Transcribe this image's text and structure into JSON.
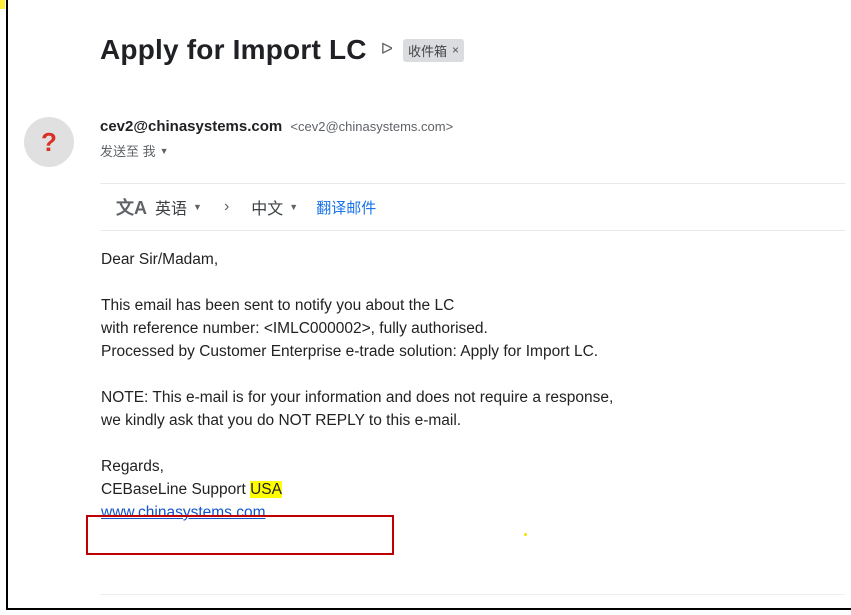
{
  "email": {
    "subject": "Apply for Import LC",
    "label_icon": "label-arrow-icon",
    "label_chip": "收件箱",
    "label_chip_close": "×"
  },
  "sender": {
    "avatar_icon": "?",
    "name": "cev2@chinasystems.com",
    "address": "<cev2@chinasystems.com>",
    "to_text": "发送至 我",
    "to_caret": "▼"
  },
  "translate": {
    "icon": "文A",
    "source_lang": "英语",
    "arrow": "›",
    "target_lang": "中文",
    "caret": "▼",
    "translate_link": "翻译邮件"
  },
  "body": {
    "greeting": "Dear Sir/Madam,",
    "para1": [
      "This email has been sent to notify you about the LC",
      "with reference number: <IMLC000002>, fully authorised.",
      "Processed by Customer Enterprise e-trade solution: Apply for Import LC."
    ],
    "para2": [
      "NOTE: This e-mail is for your information and does not require a response,",
      "we kindly ask that you do NOT REPLY to this e-mail."
    ],
    "regards": "Regards,",
    "signature_prefix": "CEBaseLine Support ",
    "signature_highlight": "USA",
    "website": "www.chinasystems.com"
  },
  "colors": {
    "highlight": "#ffff00",
    "annotation_box": "#c00000",
    "link": "#1155cc",
    "translate_link": "#1a73e8"
  }
}
